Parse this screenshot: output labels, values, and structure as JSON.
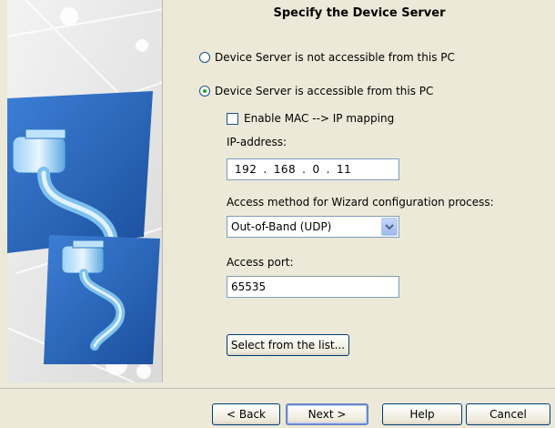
{
  "title": "Specify the Device Server",
  "options": {
    "not_accessible": "Device Server is not accessible from this PC",
    "accessible": "Device Server is accessible from this PC",
    "selected": "accessible"
  },
  "mac_mapping": {
    "label": "Enable MAC --> IP mapping",
    "checked": false
  },
  "ip_address": {
    "label": "IP-address:",
    "octet1": "192",
    "octet2": "168",
    "octet3": "0",
    "octet4": "11"
  },
  "access_method": {
    "label": "Access method for Wizard configuration process:",
    "value": "Out-of-Band (UDP)"
  },
  "access_port": {
    "label": "Access port:",
    "value": "65535"
  },
  "select_list_button": "Select from the list...",
  "footer": {
    "back": "< Back",
    "next": "Next >",
    "help": "Help",
    "cancel": "Cancel"
  },
  "colors": {
    "dialog_bg": "#ECE9D8",
    "panel_blue": "#2a64b8",
    "button_border": "#003c74",
    "radio_dot": "#21a121"
  },
  "icons": [
    "network-cable-icon",
    "network-plug-icon",
    "chevron-down-icon"
  ]
}
